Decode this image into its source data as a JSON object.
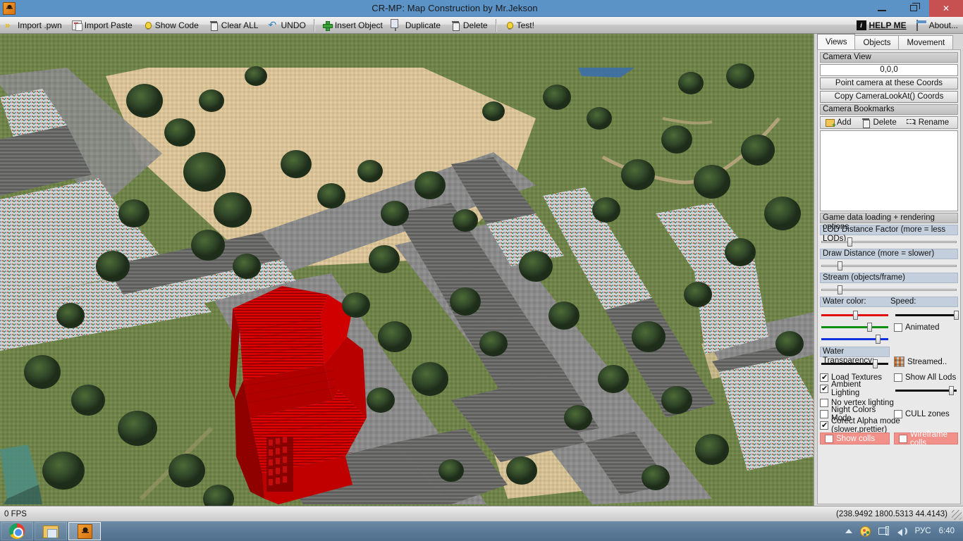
{
  "window": {
    "title": "CR-MP: Map Construction by Mr.Jekson",
    "icon": "app-icon",
    "minimize": "–",
    "maximize": "❐",
    "close": "✕"
  },
  "toolbar": {
    "items": [
      {
        "icon": "import-chevrons-icon",
        "label": "Import .pwn"
      },
      {
        "icon": "import-paste-icon",
        "label": "Import Paste"
      },
      {
        "icon": "lightbulb-icon",
        "label": "Show Code"
      },
      {
        "icon": "trash-icon",
        "label": "Clear ALL"
      },
      {
        "icon": "undo-arrow-icon",
        "label": "UNDO"
      },
      {
        "icon": "green-plus-icon",
        "label": "Insert Object"
      },
      {
        "icon": "duplicate-icon",
        "label": "Duplicate"
      },
      {
        "icon": "trash-icon",
        "label": "Delete"
      },
      {
        "icon": "lightbulb-icon",
        "label": "Test!"
      }
    ],
    "help_label": "HELP ME",
    "about_label": "About..."
  },
  "panel": {
    "tabs": [
      {
        "label": "Views",
        "active": true
      },
      {
        "label": "Objects",
        "active": false
      },
      {
        "label": "Movement",
        "active": false
      }
    ],
    "camera_view": {
      "header": "Camera View",
      "coords_value": "0,0,0",
      "point_button": "Point camera at these Coords",
      "copy_button": "Copy CameraLookAt() Coords"
    },
    "camera_bookmarks": {
      "header": "Camera Bookmarks",
      "add_label": "Add",
      "delete_label": "Delete",
      "rename_label": "Rename",
      "list_items": []
    },
    "rendering": {
      "header": "Game data loading + rendering options",
      "sliders": [
        {
          "label": "LOD Distance Factor (more = less LODs)",
          "value": 20,
          "color": "#555555"
        },
        {
          "label": "Draw Distance (more = slower)",
          "value": 13,
          "color": "#555555"
        },
        {
          "label": "Stream (objects/frame)",
          "value": 13,
          "color": "#555555"
        }
      ],
      "water_color_label": "Water color:",
      "speed_label": "Speed:",
      "water_sliders": [
        {
          "name": "red",
          "value": 48,
          "color": "#e01010"
        },
        {
          "name": "green",
          "value": 68,
          "color": "#109010"
        },
        {
          "name": "blue",
          "value": 80,
          "color": "#1030e0"
        }
      ],
      "speed_slider": {
        "value": 95,
        "color": "#111111"
      },
      "animated_label": "Animated",
      "animated_checked": false,
      "water_transparency_label": "Water Transparency:",
      "water_transparency_value": 78,
      "streamed_label": "Streamed..",
      "ambient_slider_value": 88,
      "checkboxes": [
        {
          "label": "Load Textures",
          "checked": true
        },
        {
          "label": "Show All Lods",
          "checked": false
        },
        {
          "label": "Ambient Lighting",
          "checked": true
        },
        {
          "label": "No vertex lighting",
          "checked": false
        },
        {
          "label": "Night Colors Mode",
          "checked": false
        },
        {
          "label": "CULL zones",
          "checked": false
        },
        {
          "label": "Corect Alpha mode (slower,prettier)",
          "checked": true
        }
      ],
      "red_buttons": [
        {
          "label": "Show colls",
          "checked": false
        },
        {
          "label": "Wireframe colls",
          "checked": false
        }
      ]
    }
  },
  "statusbar": {
    "fps": "0 FPS",
    "coords": "(238.9492 1800.5313 44.4143)"
  },
  "taskbar": {
    "buttons": [
      {
        "icon": "chrome-icon",
        "active": false
      },
      {
        "icon": "explorer-icon",
        "active": false
      },
      {
        "icon": "crmp-icon",
        "active": true
      }
    ],
    "tray": {
      "language": "РУС",
      "time": "6:40"
    }
  },
  "viewport": {
    "description": "3D aerial view of a city map with a selected building highlighted in red",
    "colors": {
      "grass": "#6f8248",
      "sand": "#d8c296",
      "road": "#8c8c8c",
      "roof": "#6a6a68",
      "selection_red": "#cc0000",
      "water": "#3c6fa8"
    }
  }
}
